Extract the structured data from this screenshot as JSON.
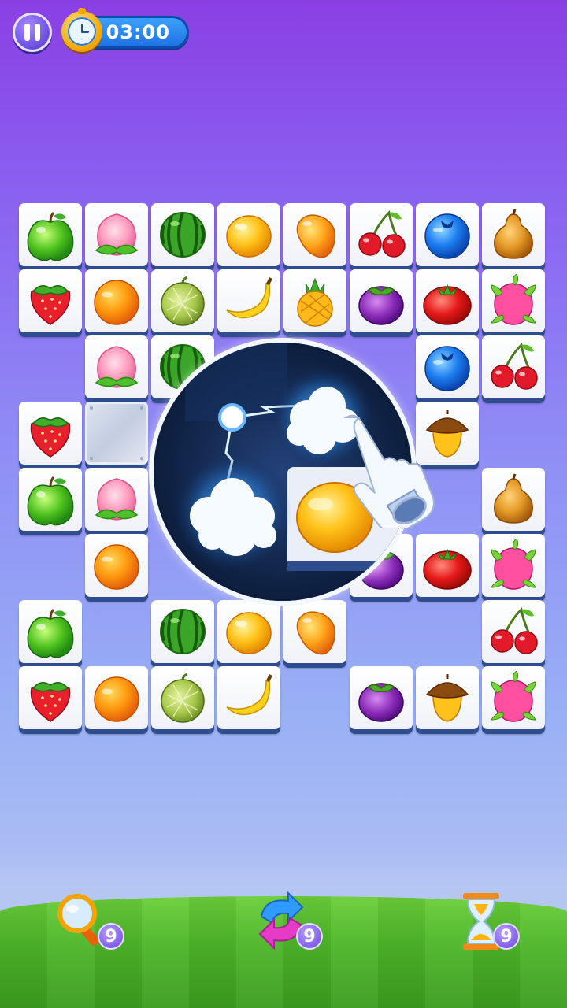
{
  "hud": {
    "timer": "03:00",
    "icons": {
      "pause": "pause-icon",
      "clock": "clock-icon"
    }
  },
  "board": {
    "columns": 8,
    "rows": 8,
    "cells": [
      [
        "apple",
        "peach",
        "watermelon",
        "lemon",
        "mango",
        "cherry",
        "blueberry",
        "pear"
      ],
      [
        "strawberry",
        "orange",
        "melon",
        "banana",
        "pineapple",
        "mangosteen",
        "tomato",
        "dragonfruit"
      ],
      [
        null,
        "peach",
        "watermelon",
        "hidden",
        "hidden",
        null,
        "blueberry",
        "cherry"
      ],
      [
        "strawberry",
        "ice-block",
        "hidden",
        "hidden",
        "hidden",
        "hidden",
        "acorn",
        null
      ],
      [
        "apple",
        "peach",
        "hidden",
        "hidden",
        "hidden",
        "hidden",
        null,
        "pear"
      ],
      [
        null,
        "orange",
        "hidden",
        "hidden",
        "hidden",
        "mangosteen",
        "tomato",
        "dragonfruit"
      ],
      [
        "apple",
        null,
        "watermelon",
        "lemon",
        "mango",
        null,
        null,
        "cherry"
      ],
      [
        "strawberry",
        "orange",
        "melon",
        "banana",
        null,
        "mangosteen",
        "acorn",
        "dragonfruit"
      ]
    ]
  },
  "tutorial": {
    "icons": [
      "lightning-orb-icon",
      "cloud-puff-icon",
      "lemon-icon",
      "hand-pointer-icon"
    ]
  },
  "boosters": [
    {
      "name": "hint",
      "icon": "magnifier-icon",
      "count": "9"
    },
    {
      "name": "shuffle",
      "icon": "shuffle-arrows-icon",
      "count": "9"
    },
    {
      "name": "add-time",
      "icon": "hourglass-icon",
      "count": "9"
    }
  ],
  "colors": {
    "sky_top": "#8a3fe3",
    "sky_bottom": "#b6c6f3",
    "tile_shadow": "#2f4d8e",
    "grass": "#4fb82a",
    "badge": "#7a5ae8"
  }
}
